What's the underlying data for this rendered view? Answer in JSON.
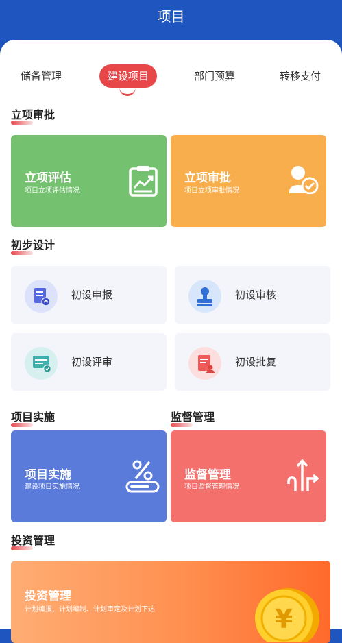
{
  "header": {
    "title": "项目"
  },
  "tabs": [
    {
      "label": "储备管理"
    },
    {
      "label": "建设项目"
    },
    {
      "label": "部门预算"
    },
    {
      "label": "转移支付"
    }
  ],
  "sections": {
    "approval": "立项审批",
    "design": "初步设计",
    "implementation": "项目实施",
    "supervision": "监督管理",
    "investment": "投资管理"
  },
  "cards": {
    "evaluation": {
      "title": "立项评估",
      "subtitle": "项目立项评估情况",
      "icon": "clipboard-chart-icon",
      "color": "#74c26f"
    },
    "approval": {
      "title": "立项审批",
      "subtitle": "项目立项审批情况",
      "icon": "user-check-icon",
      "color": "#f8ae4c"
    },
    "implementation": {
      "title": "项目实施",
      "subtitle": "建设项目实施情况",
      "icon": "percent-progress-icon",
      "color": "#5b7bdb"
    },
    "supervision": {
      "title": "监督管理",
      "subtitle": "项目监督管理情况",
      "icon": "route-arrows-icon",
      "color": "#f3706c"
    },
    "investment": {
      "title": "投资管理",
      "subtitle": "计划编报、计划编制、计划审定及计划下达",
      "icon": "yuan-coin-icon",
      "color": "#ff8a4a"
    }
  },
  "tiles": [
    {
      "label": "初设申报",
      "icon": "document-upload-icon"
    },
    {
      "label": "初设审核",
      "icon": "stamp-icon"
    },
    {
      "label": "初设评审",
      "icon": "review-card-icon"
    },
    {
      "label": "初设批复",
      "icon": "reply-document-icon"
    }
  ],
  "coin_symbol": "¥"
}
